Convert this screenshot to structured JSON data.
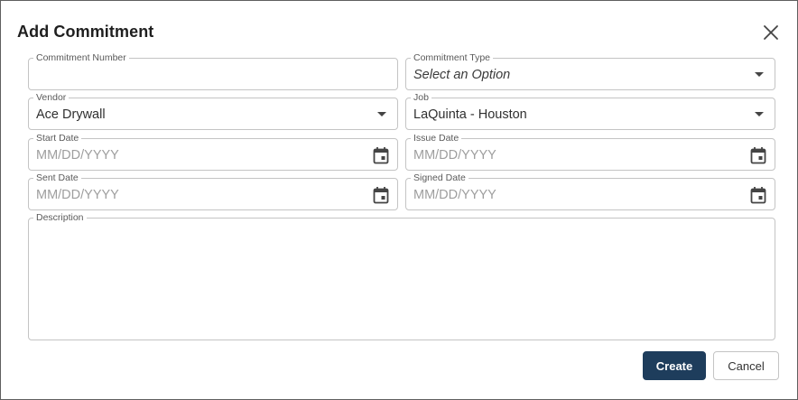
{
  "dialog": {
    "title": "Add Commitment",
    "close_icon": "close-icon"
  },
  "form": {
    "commitment_number": {
      "label": "Commitment Number",
      "value": ""
    },
    "commitment_type": {
      "label": "Commitment Type",
      "placeholder": "Select an Option"
    },
    "vendor": {
      "label": "Vendor",
      "value": "Ace Drywall"
    },
    "job": {
      "label": "Job",
      "value": "LaQuinta - Houston"
    },
    "start_date": {
      "label": "Start Date",
      "placeholder": "MM/DD/YYYY"
    },
    "issue_date": {
      "label": "Issue Date",
      "placeholder": "MM/DD/YYYY"
    },
    "sent_date": {
      "label": "Sent Date",
      "placeholder": "MM/DD/YYYY"
    },
    "signed_date": {
      "label": "Signed Date",
      "placeholder": "MM/DD/YYYY"
    },
    "description": {
      "label": "Description",
      "value": ""
    }
  },
  "actions": {
    "create_label": "Create",
    "cancel_label": "Cancel"
  },
  "colors": {
    "primary": "#1e3d5c",
    "border": "#c4c4c4"
  }
}
